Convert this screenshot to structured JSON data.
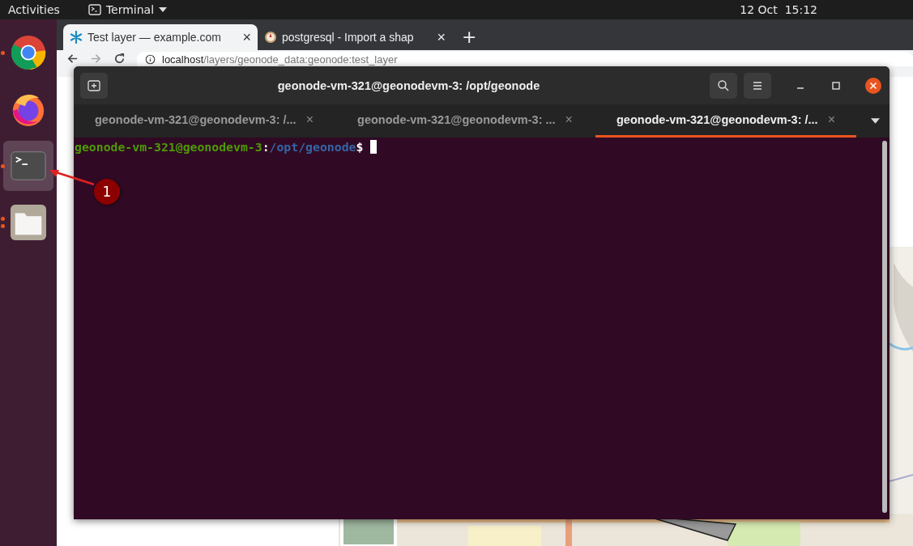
{
  "top_bar": {
    "activities": "Activities",
    "app_menu": "Terminal",
    "clock": "12 Oct  15:12"
  },
  "dock": {
    "items": [
      {
        "kind": "chrome",
        "selected": false,
        "running": true,
        "multiple": false
      },
      {
        "kind": "firefox",
        "selected": false,
        "running": false,
        "multiple": false
      },
      {
        "kind": "terminal",
        "selected": true,
        "running": true,
        "multiple": false
      },
      {
        "kind": "files",
        "selected": false,
        "running": true,
        "multiple": true
      }
    ]
  },
  "browser": {
    "tabs": [
      {
        "title": "Test layer — example.com",
        "selected": true
      },
      {
        "title": "postgresql - Import a shap",
        "selected": false
      }
    ],
    "close": "×",
    "new_tab": "+",
    "url": {
      "host": "localhost",
      "path": "/layers/geonode_data:geonode:test_layer"
    }
  },
  "terminal": {
    "title": "geonode-vm-321@geonodevm-3: /opt/geonode",
    "tabs": [
      {
        "title": "geonode-vm-321@geonodevm-3: /...",
        "selected": false
      },
      {
        "title": "geonode-vm-321@geonodevm-3: ...",
        "selected": false
      },
      {
        "title": "geonode-vm-321@geonodevm-3: /...",
        "selected": true
      }
    ],
    "tab_close": "×",
    "prompt": {
      "user": "geonode-vm-321@geonodevm-3",
      "separator": ":",
      "path": "/opt/geonode",
      "symbol": "$"
    }
  },
  "annotation": {
    "label": "1"
  }
}
